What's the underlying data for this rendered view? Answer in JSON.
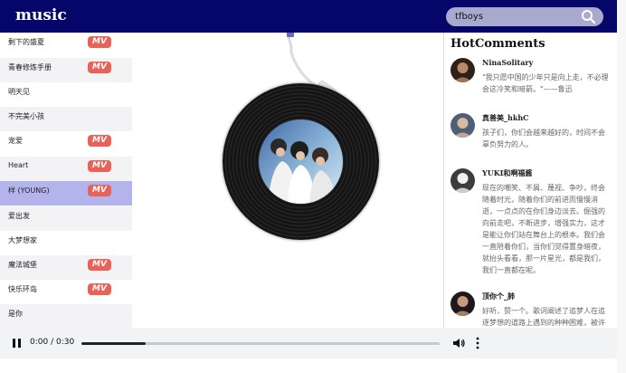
{
  "app": {
    "logo": "music"
  },
  "search": {
    "value": "tfboys",
    "icon": "search-icon"
  },
  "songs": [
    {
      "name": "剩下的盛夏",
      "mv": true,
      "mv_label": "MV"
    },
    {
      "name": "青春修炼手册",
      "mv": true,
      "mv_label": "MV"
    },
    {
      "name": "明天见",
      "mv": false
    },
    {
      "name": "不完美小孩",
      "mv": false
    },
    {
      "name": "宠爱",
      "mv": true,
      "mv_label": "MV"
    },
    {
      "name": "Heart",
      "mv": true,
      "mv_label": "MV"
    },
    {
      "name": "样 (YOUNG)",
      "mv": true,
      "mv_label": "MV",
      "active": true
    },
    {
      "name": "爱出发",
      "mv": false
    },
    {
      "name": "大梦想家",
      "mv": false
    },
    {
      "name": "魔法城堡",
      "mv": true,
      "mv_label": "MV"
    },
    {
      "name": "快乐环岛",
      "mv": true,
      "mv_label": "MV"
    },
    {
      "name": "是你",
      "mv": false
    }
  ],
  "comments": {
    "title": "HotComments",
    "items": [
      {
        "user": "NinaSolitary",
        "text": "\"我只愿中国的少年只是向上走，不必理会这冷笑和暗箭。\"——鲁迅"
      },
      {
        "user": "真善美_hkhC",
        "text": "孩子们，你们会越来越好的，时间不会辜负努力的人。"
      },
      {
        "user": "YUKI和啊福酱",
        "text": "现在的嘲笑、不屑、蔑视、争吵，终会随着时光，随着你们的前进而慢慢消逝，一点点的在你们身边淡去。倔强的向前走吧，不断进步，增强实力，这才是能让你们站在舞台上的根本。我们会一直陪着你们，当你们觉得置身暗夜，就抬头看看，那一片星光，都是我们，我们一直都在呢。"
      },
      {
        "user": "顶你个_肺",
        "text": "好听，赞一个。歌词阐述了追梦人在追逐梦想的道路上遇到的种种困难，被许多人嘲笑"
      }
    ]
  },
  "player": {
    "time": "0:00 / 0:30",
    "progress": 0.18,
    "play_state": "pause-icon",
    "volume_icon": "volume-icon",
    "more_icon": "more-vert-icon"
  },
  "colors": {
    "header_bg": "#06066a",
    "mv_badge": "#e8625a",
    "active_row": "#b4b4ec",
    "search_bg": "#a9a9cf"
  }
}
